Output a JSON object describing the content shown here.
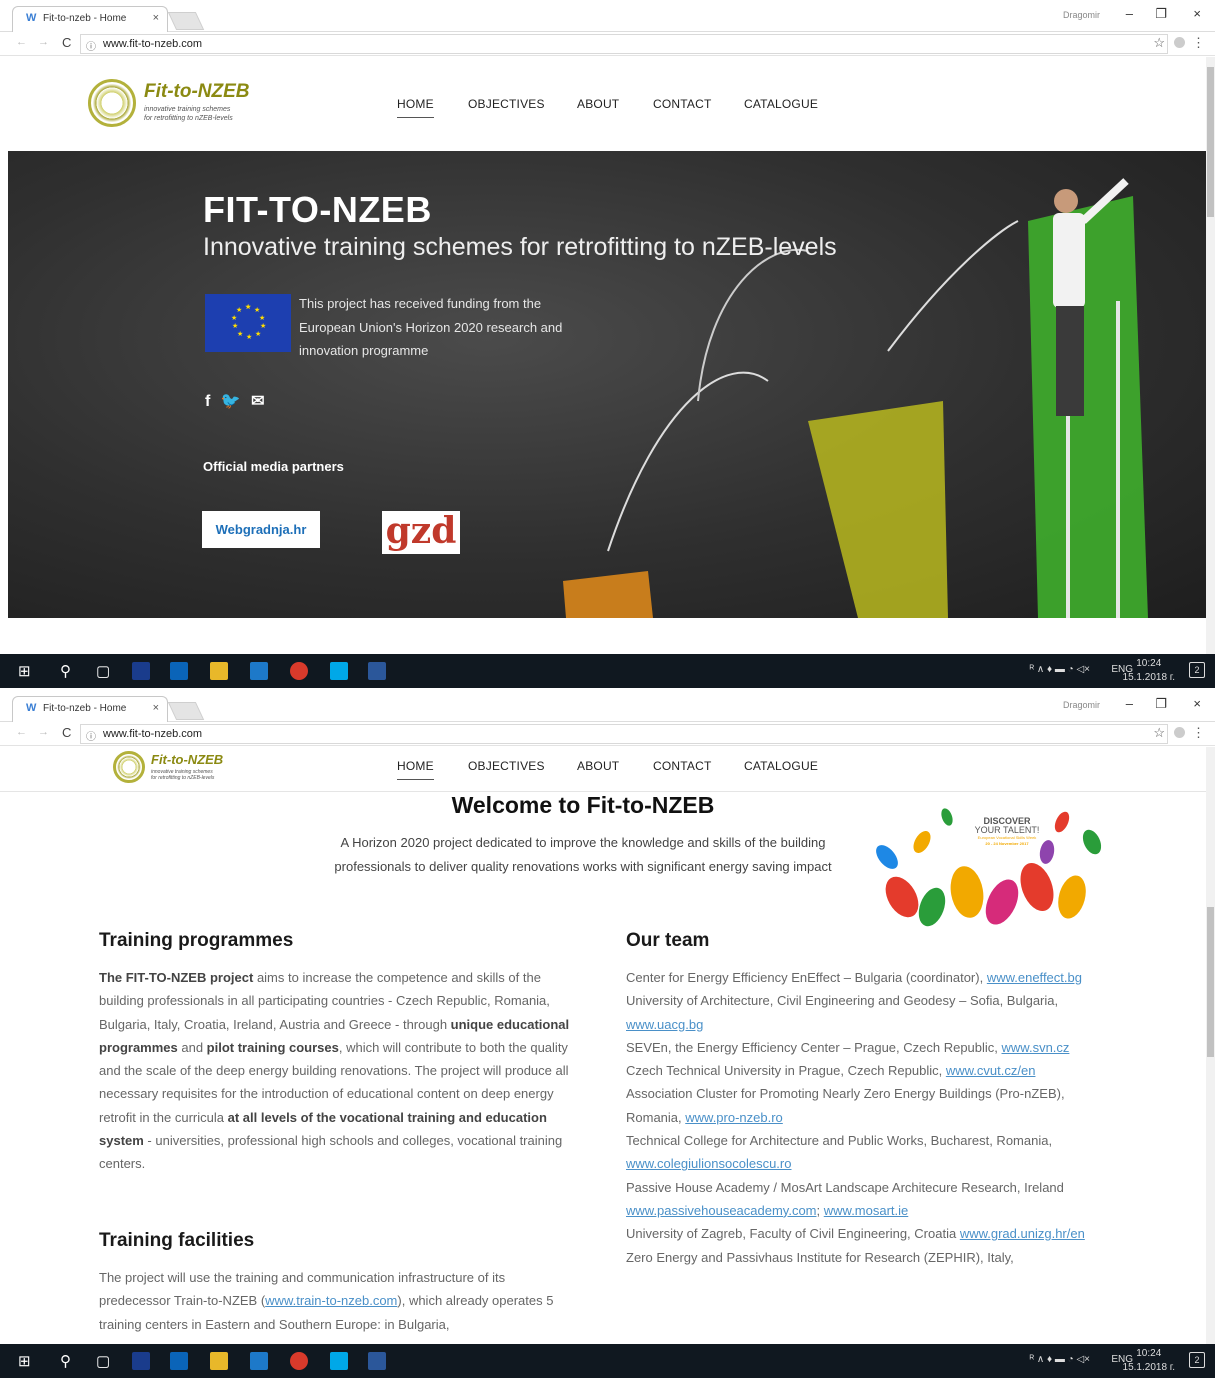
{
  "browser": {
    "tab_favicon": "W",
    "tab_title": "Fit-to-nzeb - Home",
    "tab_close": "×",
    "profile_name": "Dragomir",
    "url": "www.fit-to-nzeb.com",
    "info_icon": "ⓘ",
    "star_icon": "☆",
    "menu_icon": "⋮",
    "back_icon": "←",
    "forward_icon": "→",
    "reload_icon": "C",
    "minimize_icon": "–",
    "restore_icon": "❐",
    "close_icon": "×"
  },
  "site": {
    "logo_wordmark": "Fit-to-NZEB",
    "logo_tagline_1": "innovative training schemes",
    "logo_tagline_2": "for retrofitting to nZEB-levels",
    "nav": [
      "HOME",
      "OBJECTIVES",
      "ABOUT",
      "CONTACT",
      "CATALOGUE"
    ]
  },
  "hero": {
    "title": "FIT-TO-NZEB",
    "subtitle": "Innovative training schemes for retrofitting to nZEB-levels",
    "eu_text": "This project has received funding from the European Union's Horizon 2020 research and innovation programme",
    "social": {
      "facebook": "f",
      "twitter": "🐦",
      "email": "✉"
    },
    "media_partners_title": "Official media partners",
    "partner_1": "Webgradnja.hr",
    "partner_2": "gzd"
  },
  "welcome": {
    "title": "Welcome to Fit-to-NZEB",
    "text": "A Horizon 2020 project dedicated to improve the knowledge and skills of the building professionals to deliver quality renovations works with significant energy saving impact",
    "discover_line1": "DISCOVER",
    "discover_line2": "YOUR TALENT!",
    "discover_line3": "European Vocational Skills Week",
    "discover_line4": "20 - 24 November 2017"
  },
  "training_programmes": {
    "title": "Training programmes",
    "p_lead": "The FIT-TO-NZEB project",
    "p1": " aims to increase the competence and skills of the building professionals in all participating countries - Czech Republic, Romania, Bulgaria, Italy, Croatia, Ireland, Austria and Greece - through ",
    "b1": "unique educational programmes",
    "p2": " and ",
    "b2": "pilot training courses",
    "p3": ", which will contribute to both the quality and the scale of the deep energy building renovations. The project will produce all necessary requisites for the introduction of educational content on deep energy retrofit in the curricula ",
    "b3": "at all levels of the vocational training and education system",
    "p4": " - universities, professional high schools and colleges, vocational training centers."
  },
  "training_facilities": {
    "title": "Training facilities",
    "p1": "The project will use the training and communication infrastructure of its predecessor Train-to-NZEB (",
    "link": "www.train-to-nzeb.com",
    "p2": "), which already operates 5 training centers in Eastern and Southern Europe: in Bulgaria,"
  },
  "our_team": {
    "title": "Our team",
    "members": [
      {
        "text": "Center for Energy Efficiency EnEffect – Bulgaria (coordinator), ",
        "link": "www.eneffect.bg"
      },
      {
        "text": "University of Architecture, Civil Engineering and Geodesy – Sofia, Bulgaria, ",
        "link": "www.uacg.bg"
      },
      {
        "text": "SEVEn, the Energy Efficiency Center – Prague, Czech Republic, ",
        "link": "www.svn.cz"
      },
      {
        "text": "Czech Technical University in Prague, Czech Republic, ",
        "link": "www.cvut.cz/en"
      },
      {
        "text": "Association Cluster for Promoting Nearly Zero Energy Buildings (Pro-nZEB), Romania, ",
        "link": "www.pro-nzeb.ro"
      },
      {
        "text": "Technical College for Architecture and Public Works, Bucharest, Romania, ",
        "link": "www.colegiulionsocolescu.ro"
      },
      {
        "text": "Passive House Academy / MosArt Landscape Architecure Research, Ireland ",
        "link": "www.passivehouseacademy.com",
        "link2": "www.mosart.ie"
      },
      {
        "text": "University of Zagreb, Faculty of Civil Engineering, Croatia ",
        "link": "www.grad.unizg.hr/en"
      },
      {
        "text": "Zero Energy and Passivhaus Institute for Research (ZEPHIR), Italy,",
        "link": ""
      }
    ]
  },
  "taskbar": {
    "lang": "ENG",
    "time": "10:24",
    "date": "15.1.2018 г.",
    "notifications": "2",
    "start_icon": "⊞",
    "search_icon": "⚲",
    "taskview_icon": "▢",
    "tray_icons": "ᴿ ∧ ♦ ▬ ◔ ◁×"
  },
  "colors": {
    "accent_olive": "#8b8a12",
    "link_blue": "#4a90c8",
    "eu_blue": "#1d3fb0",
    "taskbar": "#101820"
  }
}
